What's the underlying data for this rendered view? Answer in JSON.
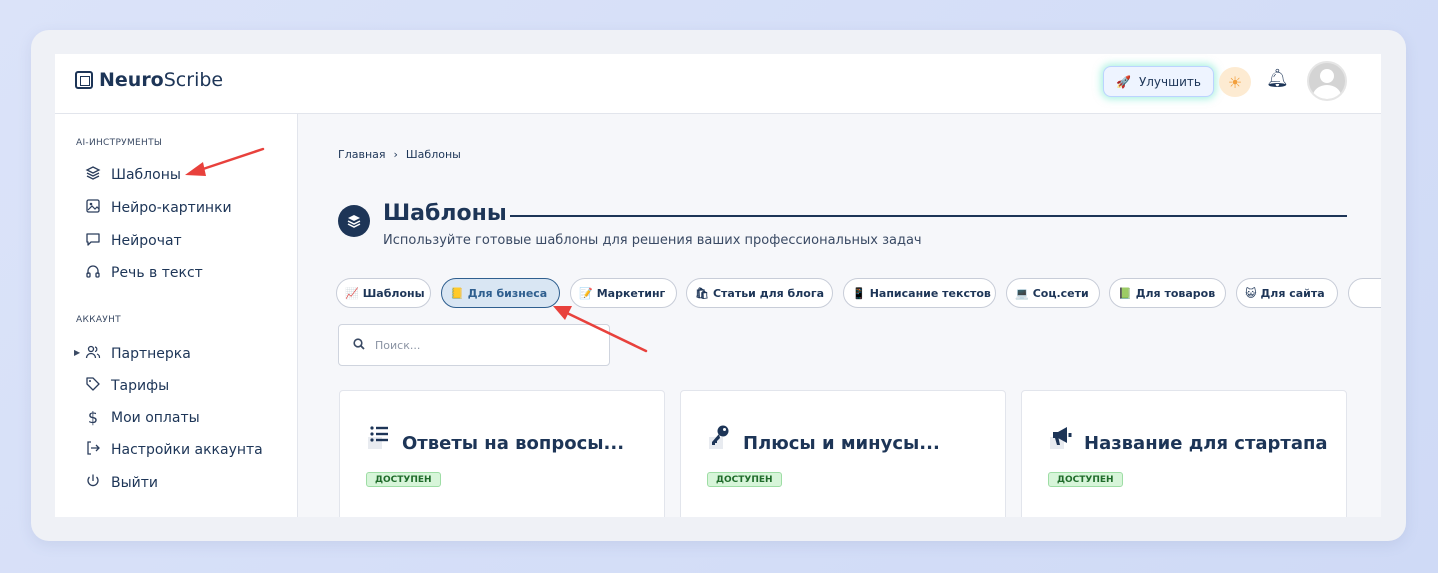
{
  "header": {
    "logo_bold": "Neuro",
    "logo_rest": "Scribe",
    "upgrade_label": "Улучшить"
  },
  "sidebar": {
    "tools_label": "AI-ИНСТРУМЕНТЫ",
    "tools": [
      {
        "label": "Шаблоны",
        "icon": "layers-icon"
      },
      {
        "label": "Нейро-картинки",
        "icon": "image-icon"
      },
      {
        "label": "Нейрочат",
        "icon": "chat-icon"
      },
      {
        "label": "Речь в текст",
        "icon": "headphones-icon"
      }
    ],
    "account_label": "АККАУНТ",
    "account": [
      {
        "label": "Партнерка",
        "icon": "users-icon"
      },
      {
        "label": "Тарифы",
        "icon": "tag-icon"
      },
      {
        "label": "Мои оплаты",
        "icon": "dollar-icon"
      },
      {
        "label": "Настройки аккаунта",
        "icon": "settings-exit-icon"
      },
      {
        "label": "Выйти",
        "icon": "power-icon"
      }
    ]
  },
  "breadcrumb": {
    "home": "Главная",
    "separator": "›",
    "current": "Шаблоны"
  },
  "page": {
    "title": "Шаблоны",
    "subtitle": "Используйте готовые шаблоны для решения ваших профессиональных задач"
  },
  "tags": [
    {
      "label": "Шаблоны",
      "emoji": "📈"
    },
    {
      "label": "Для бизнеса",
      "emoji": "📒"
    },
    {
      "label": "Маркетинг",
      "emoji": "📝"
    },
    {
      "label": "Статьи для блога",
      "emoji": "🛍"
    },
    {
      "label": "Написание текстов",
      "emoji": "📱"
    },
    {
      "label": "Соц.сети",
      "emoji": "💻"
    },
    {
      "label": "Для товаров",
      "emoji": "📗"
    },
    {
      "label": "Для сайта",
      "emoji": "😺"
    }
  ],
  "search": {
    "placeholder": "Поиск..."
  },
  "cards": [
    {
      "title": "Ответы на вопросы...",
      "badge": "ДОСТУПЕН",
      "icon": "list-icon"
    },
    {
      "title": "Плюсы и минусы...",
      "badge": "ДОСТУПЕН",
      "icon": "key-icon"
    },
    {
      "title": "Название для стартапа",
      "badge": "ДОСТУПЕН",
      "icon": "megaphone-icon"
    }
  ],
  "colors": {
    "primary": "#1d3557",
    "badge_bg": "#d7f5d9",
    "annotation_arrow": "#e8413c"
  }
}
